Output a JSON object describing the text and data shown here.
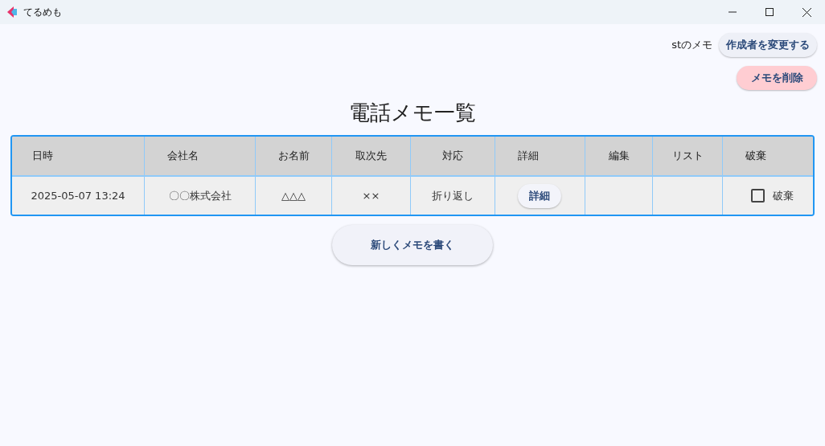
{
  "window": {
    "title": "てるめも"
  },
  "header": {
    "user_label": "stのメモ",
    "change_author_button": "作成者を変更する",
    "delete_button": "メモを削除"
  },
  "title": "電話メモ一覧",
  "table": {
    "columns": [
      "日時",
      "会社名",
      "お名前",
      "取次先",
      "対応",
      "詳細",
      "編集",
      "リスト",
      "破棄"
    ],
    "rows": [
      {
        "cells": [
          {
            "kind": "text",
            "text": "2025-05-07 13:24"
          },
          {
            "kind": "text",
            "text": "〇〇株式会社"
          },
          {
            "kind": "text",
            "text": "△△△"
          },
          {
            "kind": "text",
            "text": "××"
          },
          {
            "kind": "text",
            "text": "折り返し"
          },
          {
            "kind": "button",
            "text": "詳細"
          },
          {
            "kind": "empty"
          },
          {
            "kind": "empty"
          },
          {
            "kind": "checkbox",
            "text": "破棄",
            "checked": false
          }
        ]
      }
    ]
  },
  "new_memo_button": "新しくメモを書く"
}
